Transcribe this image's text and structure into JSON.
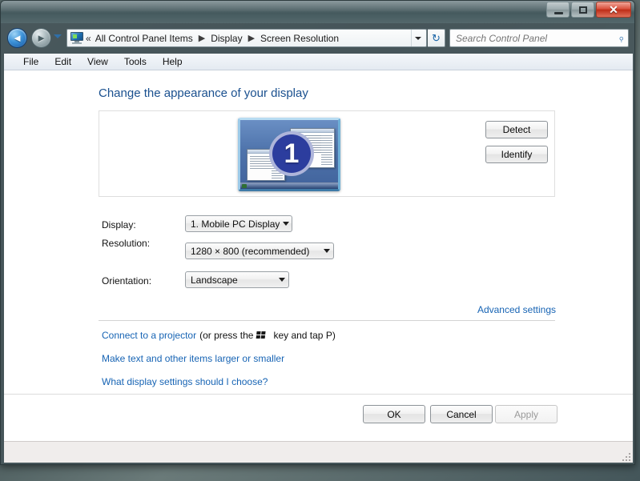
{
  "window": {
    "controls": {
      "minimize_label": "Minimize",
      "maximize_label": "Maximize",
      "close_label": "✕"
    }
  },
  "navbar": {
    "back_glyph": "◄",
    "forward_glyph": "►",
    "double_chevron": "«",
    "breadcrumbs": [
      {
        "label": "All Control Panel Items"
      },
      {
        "label": "Display"
      },
      {
        "label": "Screen Resolution"
      }
    ],
    "separator": "▶",
    "refresh_glyph": "↻",
    "address_icon": "control-panel-display-icon"
  },
  "search": {
    "placeholder": "Search Control Panel",
    "value": "",
    "icon": "search-icon",
    "icon_glyph": "⌕"
  },
  "menubar": {
    "items": [
      {
        "label": "File"
      },
      {
        "label": "Edit"
      },
      {
        "label": "View"
      },
      {
        "label": "Tools"
      },
      {
        "label": "Help"
      }
    ]
  },
  "main": {
    "page_title": "Change the appearance of your display",
    "preview": {
      "display_number": "1",
      "monitor_icon": "monitor-preview-icon"
    },
    "buttons": {
      "detect": "Detect",
      "identify": "Identify"
    },
    "fields": [
      {
        "label": "Display:",
        "value": "1. Mobile PC Display"
      },
      {
        "label": "Resolution:",
        "value": "1280 × 800 (recommended)"
      },
      {
        "label": "Orientation:",
        "value": "Landscape"
      }
    ],
    "labels": {
      "display": "Display:",
      "resolution": "Resolution:",
      "orientation": "Orientation:"
    },
    "values": {
      "display": "1. Mobile PC Display",
      "resolution": "1280 × 800 (recommended)",
      "orientation": "Landscape"
    },
    "links": {
      "advanced_settings": "Advanced settings",
      "projector": "Connect to a projector",
      "projector_tail_pre": "(or press the",
      "projector_tail_post": "key and tap P)",
      "text_size": "Make text and other items larger or smaller",
      "what_choose": "What display settings should I choose?"
    },
    "dialog_buttons": {
      "ok": "OK",
      "cancel": "Cancel",
      "apply": "Apply"
    }
  },
  "statusbar": {
    "text": ""
  },
  "colors": {
    "link": "#1764b4",
    "heading": "#1a508f",
    "titlebar": "#4f6266",
    "close_button": "#bf2d18",
    "monitor_badge": "#2c3d9e"
  }
}
